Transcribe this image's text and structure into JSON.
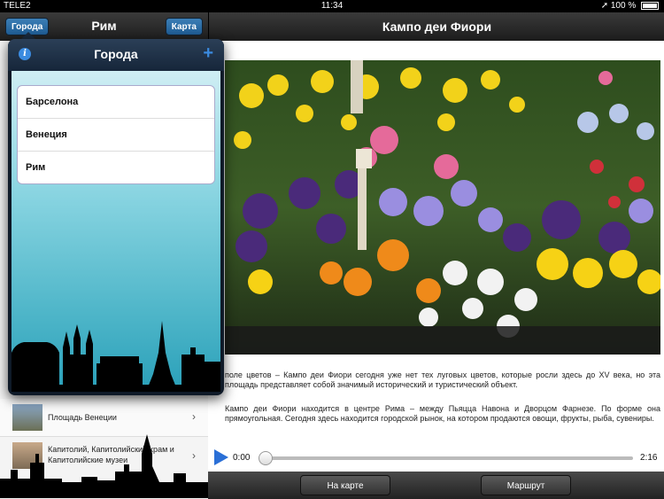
{
  "status_bar": {
    "carrier": "TELE2",
    "time": "11:34",
    "battery": "100 %"
  },
  "left_nav": {
    "cities_button": "Города",
    "title": "Рим",
    "map_button": "Карта"
  },
  "popover": {
    "title": "Города",
    "info_icon": "info-icon",
    "add_icon": "plus-icon",
    "cities": [
      "Барселона",
      "Венеция",
      "Рим"
    ]
  },
  "places": [
    {
      "label": "Площадь Венеции"
    },
    {
      "label": "Капитолий, Капитолийский храм и Капитолийские музеи"
    }
  ],
  "detail": {
    "title": "Кампо деи Фиори",
    "paragraph1": "поле цветов – Кампо деи Фиори сегодня уже нет тех луговых цветов, которые росли здесь до XV века, но эта площадь представляет собой значимый исторический и туристический объект.",
    "paragraph2": "Кампо деи Фиори находится в центре Рима – между Пьяцца Навона и Дворцом Фарнезе. По форме она прямоугольная. Сегодня здесь находится городской рынок, на котором продаются овощи, фрукты, рыба, сувениры.",
    "audio": {
      "current": "0:00",
      "total": "2:16",
      "progress": 0
    },
    "on_map_button": "На карте",
    "route_button": "Маршрут"
  },
  "colors": {
    "accent": "#2a6fd6",
    "nav_dark": "#2a2a2a",
    "popover_bg": "#86d3e0"
  }
}
